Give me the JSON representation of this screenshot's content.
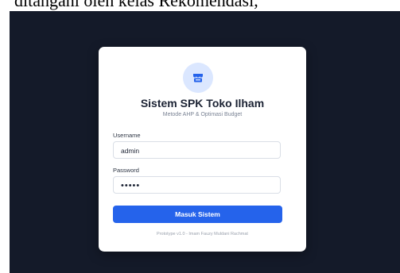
{
  "document": {
    "caption_fragment": "ditangani oleh kelas Rekomendasi,"
  },
  "app": {
    "title": "Sistem SPK Toko Ilham",
    "subtitle": "Metode AHP & Optimasi Budget",
    "logo_icon": "store-icon",
    "accent_color": "#2563eb",
    "background_color": "#141a29"
  },
  "form": {
    "username_label": "Username",
    "username_value": "admin",
    "password_label": "Password",
    "password_value": "•••••",
    "submit_label": "Masuk Sistem"
  },
  "footer": {
    "text": "Prototype v1.0 - Imam Fauzy Muldani Rachmat"
  }
}
